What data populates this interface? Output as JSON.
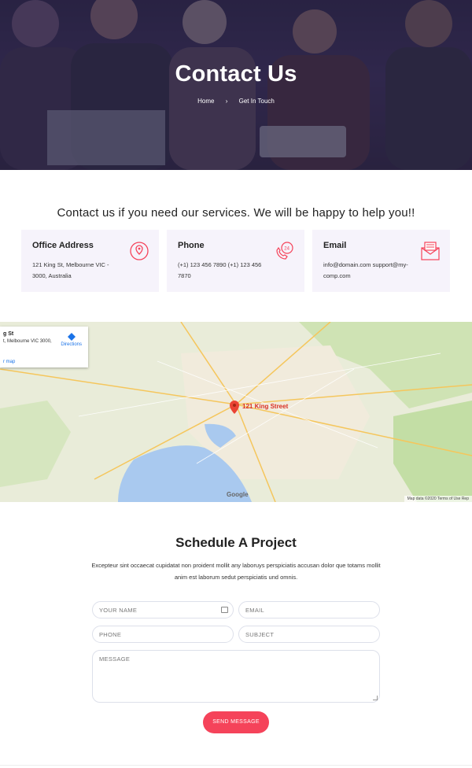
{
  "hero": {
    "title": "Contact Us",
    "breadcrumb": {
      "home": "Home",
      "separator": "›",
      "current": "Get In Touch"
    }
  },
  "intro": "Contact us if you need our services. We will be happy to help you!!",
  "cards": [
    {
      "title": "Office Address",
      "text": "121 King St, Melbourne VIC - 3000, Australia",
      "icon": "location-icon"
    },
    {
      "title": "Phone",
      "text": "(+1) 123 456 7890 (+1) 123 456 7870",
      "icon": "phone-24-icon"
    },
    {
      "title": "Email",
      "text": "info@domain.com support@my-comp.com",
      "icon": "envelope-icon"
    }
  ],
  "map": {
    "place_title": "g St",
    "place_address": "t, Melbourne VIC 3000,",
    "directions": "Directions",
    "larger_map": "r map",
    "pin_label": "121 King Street",
    "google": "Google",
    "credit": "Map data ©2020   Terms of Use   Rep"
  },
  "schedule": {
    "title": "Schedule A Project",
    "description": "Excepteur sint occaecat cupidatat non proident mollit any laboruys perspiciatis accusan dolor que totams mollit anim est laborum sedut perspiciatis und omnis."
  },
  "form": {
    "name_placeholder": "YOUR NAME",
    "email_placeholder": "EMAIL",
    "phone_placeholder": "PHONE",
    "subject_placeholder": "SUBJECT",
    "message_placeholder": "MESSAGE",
    "submit": "SEND MESSAGE"
  },
  "colors": {
    "accent": "#f5435a",
    "card_bg": "#f6f3fb",
    "hero_overlay": "#2a2540"
  }
}
